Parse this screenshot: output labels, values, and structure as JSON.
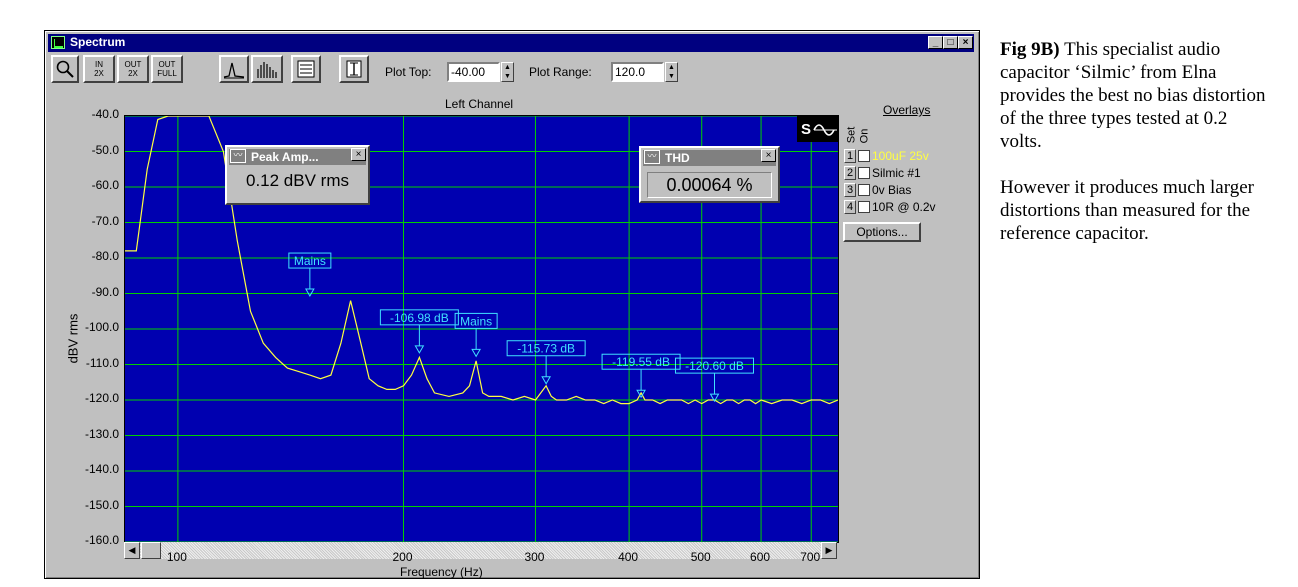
{
  "window": {
    "title": "Spectrum",
    "controls": [
      "_",
      "□",
      "×"
    ]
  },
  "toolbar": {
    "zoom_in_2x": [
      "IN",
      "2X"
    ],
    "zoom_out_2x": [
      "OUT",
      "2X"
    ],
    "zoom_out_full": [
      "OUT",
      "FULL"
    ],
    "plot_top_label": "Plot Top:",
    "plot_top_value": "-40.00",
    "plot_range_label": "Plot Range:",
    "plot_range_value": "120.0"
  },
  "overlays": {
    "title": "Overlays",
    "header_set": "Set",
    "header_on": "On",
    "items": [
      {
        "num": "1",
        "label": "100uF 25v",
        "color": "#ffff40"
      },
      {
        "num": "2",
        "label": "Silmic #1",
        "color": "#000000"
      },
      {
        "num": "3",
        "label": "0v Bias",
        "color": "#000000"
      },
      {
        "num": "4",
        "label": "10R @ 0.2v",
        "color": "#000000"
      }
    ],
    "options_label": "Options..."
  },
  "peak_window": {
    "title": "Peak Amp...",
    "value": "0.12 dBV rms",
    "icon": "wave-icon"
  },
  "thd_window": {
    "title": "THD",
    "value": "0.00064 %",
    "icon": "wave-icon"
  },
  "chart_data": {
    "type": "line",
    "title": "Left Channel",
    "xlabel": "Frequency (Hz)",
    "ylabel": "dBV rms",
    "xscale": "log",
    "xlim": [
      85,
      760
    ],
    "ylim": [
      -160,
      -40
    ],
    "yticks": [
      "-40.0",
      "-50.0",
      "-60.0",
      "-70.0",
      "-80.0",
      "-90.0",
      "-100.0",
      "-110.0",
      "-120.0",
      "-130.0",
      "-140.0",
      "-150.0",
      "-160.0"
    ],
    "xticks": [
      "100",
      "200",
      "300",
      "400",
      "500",
      "600",
      "700"
    ],
    "grid": true,
    "background_color": "#0000b0",
    "grid_color": "#00d000",
    "trace_color": "#ffff40",
    "marker_color": "#40e0ff",
    "series": [
      {
        "x": [
          85,
          88,
          91,
          94,
          97,
          100,
          103,
          106,
          110,
          115,
          120,
          125,
          130,
          135,
          140,
          145,
          150,
          155,
          160,
          165,
          170,
          175,
          180,
          185,
          190,
          195,
          200,
          205,
          210,
          215,
          220,
          230,
          240,
          245,
          250,
          255,
          260,
          270,
          280,
          290,
          300,
          305,
          310,
          315,
          320,
          330,
          340,
          350,
          360,
          370,
          380,
          390,
          400,
          410,
          415,
          420,
          430,
          440,
          450,
          460,
          470,
          480,
          490,
          500,
          510,
          520,
          530,
          540,
          550,
          560,
          570,
          580,
          590,
          600,
          620,
          640,
          660,
          680,
          700,
          720,
          740,
          760
        ],
        "y": [
          -78,
          -78,
          -55,
          -41,
          -40,
          -40,
          -40,
          -40,
          -40,
          -50,
          -75,
          -95,
          -104,
          -108,
          -111,
          -112,
          -113,
          -114,
          -113,
          -104,
          -92,
          -103,
          -114,
          -116,
          -117,
          -117,
          -116,
          -113,
          -108,
          -114,
          -118,
          -119,
          -118,
          -116,
          -109,
          -118,
          -119,
          -119,
          -120,
          -119,
          -120,
          -118,
          -116,
          -119,
          -120,
          -120,
          -119,
          -120,
          -120,
          -121,
          -120,
          -121,
          -121,
          -120,
          -118,
          -120,
          -120,
          -121,
          -120,
          -120,
          -120,
          -121,
          -120,
          -121,
          -120,
          -120,
          -121,
          -120,
          -120,
          -121,
          -120,
          -120,
          -121,
          -120,
          -121,
          -120,
          -120,
          -121,
          -120,
          -120,
          -121,
          -120
        ]
      }
    ],
    "annotations": [
      {
        "text": "Mains",
        "x": 150,
        "y": -91
      },
      {
        "text": "-106.98 dB",
        "x": 210,
        "y": -107
      },
      {
        "text": "Mains",
        "x": 250,
        "y": -108
      },
      {
        "text": "-115.73 dB",
        "x": 310,
        "y": -115.7
      },
      {
        "text": "-119.55 dB",
        "x": 415,
        "y": -119.5
      },
      {
        "text": "-120.60 dB",
        "x": 520,
        "y": -120.6
      }
    ]
  },
  "caption": {
    "fig_label": "Fig 9B)",
    "para1": "This specialist audio capacitor ‘Silmic’ from Elna provides the best no bias distortion of the three types tested at 0.2 volts.",
    "para2": "However it produces much larger distortions than measured for the reference capacitor."
  }
}
